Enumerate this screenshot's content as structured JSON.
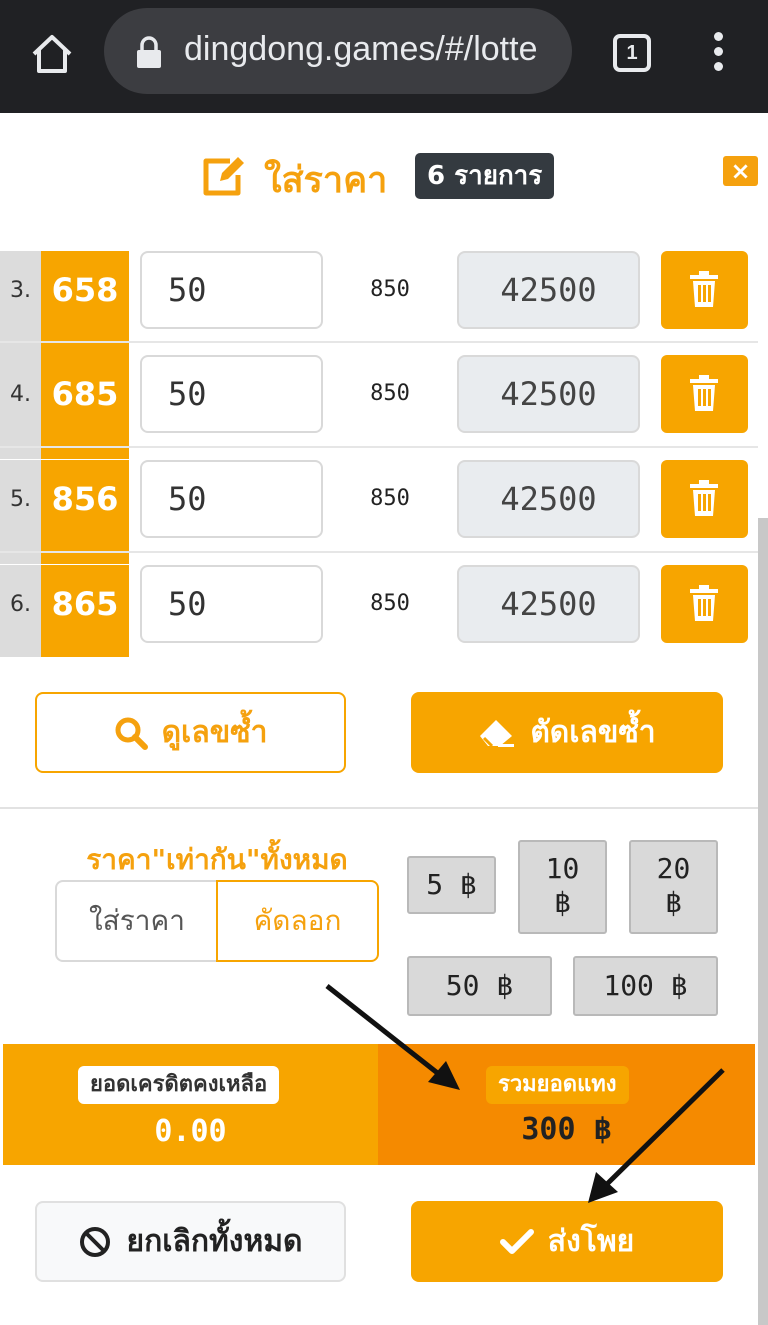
{
  "browser": {
    "url": "dingdong.games/#/lotte",
    "tab_count": "1"
  },
  "modal": {
    "title": "ใส่ราคา",
    "count_badge": "6 รายการ",
    "close_label": "×"
  },
  "rows": [
    {
      "index": "3.",
      "number": "658",
      "amount": "50",
      "rate": "850",
      "payout": "42500"
    },
    {
      "index": "4.",
      "number": "685",
      "amount": "50",
      "rate": "850",
      "payout": "42500"
    },
    {
      "index": "5.",
      "number": "856",
      "amount": "50",
      "rate": "850",
      "payout": "42500"
    },
    {
      "index": "6.",
      "number": "865",
      "amount": "50",
      "rate": "850",
      "payout": "42500"
    }
  ],
  "actions": {
    "view_duplicates": "ดูเลขซ้ำ",
    "remove_duplicates": "ตัดเลขซ้ำ"
  },
  "same_price": {
    "prefix": "ราคา",
    "emphasis": "\"เท่ากัน\"",
    "suffix": "ทั้งหมด",
    "put_price": "ใส่ราคา",
    "copy": "คัดลอก"
  },
  "chips": [
    "5 ฿",
    "10",
    "฿",
    "20",
    "฿",
    "50 ฿",
    "100 ฿"
  ],
  "summary": {
    "credit_label": "ยอดเครดิตคงเหลือ",
    "credit_value": "0.00",
    "total_label": "รวมยอดแทง",
    "total_value": "300 ฿"
  },
  "footer": {
    "cancel_all": "ยกเลิกทั้งหมด",
    "submit": "ส่งโพย"
  },
  "colors": {
    "accent": "#f7a500",
    "accent_dark": "#f58a00",
    "chrome": "#202124"
  }
}
